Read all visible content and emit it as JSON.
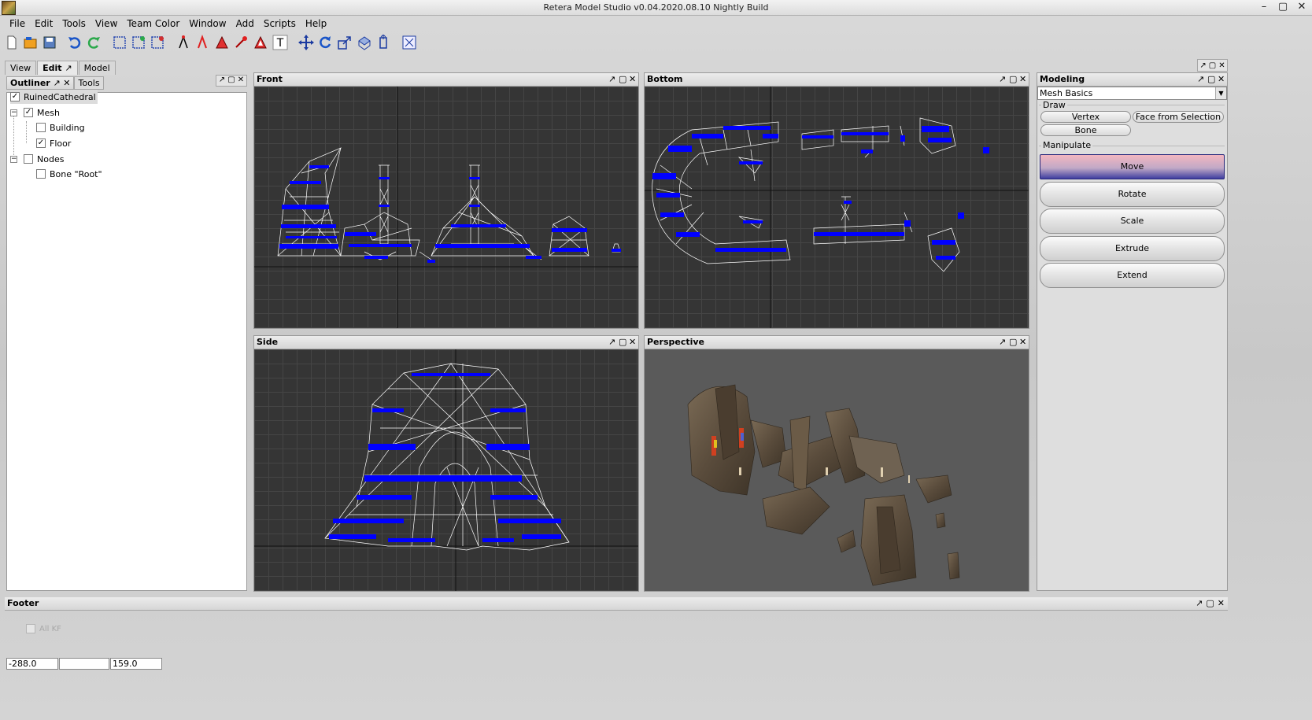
{
  "window": {
    "title": "Retera Model Studio v0.04.2020.08.10 Nightly Build"
  },
  "menu": [
    "File",
    "Edit",
    "Tools",
    "View",
    "Team Color",
    "Window",
    "Add",
    "Scripts",
    "Help"
  ],
  "toolbar_text_tool": "T",
  "main_tabs": [
    "View",
    "Edit",
    "Model"
  ],
  "outliner": {
    "tabs": [
      "Outliner",
      "Tools"
    ],
    "tree": {
      "root": "RuinedCathedral",
      "mesh": "Mesh",
      "building": "Building",
      "floor": "Floor",
      "nodes": "Nodes",
      "bone": "Bone \"Root\""
    }
  },
  "viewports": {
    "front": "Front",
    "bottom": "Bottom",
    "side": "Side",
    "perspective": "Perspective"
  },
  "modeling": {
    "title": "Modeling",
    "mode": "Mesh Basics",
    "draw_label": "Draw",
    "draw_buttons": [
      "Vertex",
      "Face from Selection",
      "Bone"
    ],
    "manipulate_label": "Manipulate",
    "manipulate_buttons": [
      "Move",
      "Rotate",
      "Scale",
      "Extrude",
      "Extend"
    ]
  },
  "footer": {
    "title": "Footer",
    "all_kf": "All KF",
    "coord_x": "-288.0",
    "coord_y": "",
    "coord_z": "159.0"
  },
  "colors": {
    "wire": "#ffffff",
    "vertex": "#0000ff",
    "viewport_bg": "#353535"
  }
}
